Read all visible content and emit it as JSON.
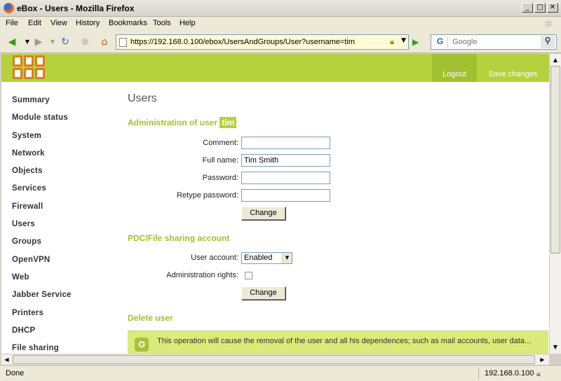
{
  "window": {
    "title": "eBox - Users - Mozilla Firefox"
  },
  "menubar": {
    "items": [
      "File",
      "Edit",
      "View",
      "History",
      "Bookmarks",
      "Tools",
      "Help"
    ]
  },
  "navbar": {
    "url": "https://192.168.0.100/ebox/UsersAndGroups/User?username=tim",
    "search_placeholder": "Google",
    "search_engine": "G"
  },
  "header": {
    "logout": "Logout",
    "save": "Save changes"
  },
  "sidebar": {
    "items": [
      "Summary",
      "Module status",
      "System",
      "Network",
      "Objects",
      "Services",
      "Firewall",
      "Users",
      "Groups",
      "OpenVPN",
      "Web",
      "Jabber Service",
      "Printers",
      "DHCP",
      "File sharing"
    ]
  },
  "main": {
    "title": "Users",
    "admin_heading": "Administration of user",
    "username": "tim",
    "fields": {
      "comment_label": "Comment:",
      "comment_value": "",
      "fullname_label": "Full name:",
      "fullname_value": "Tim Smith",
      "password_label": "Password:",
      "retype_label": "Retype password:"
    },
    "change_button": "Change",
    "pdc_heading": "PDC/File sharing account",
    "user_account_label": "User account:",
    "user_account_value": "Enabled",
    "admin_rights_label": "Administration rights:",
    "admin_rights_checked": false,
    "change_button2": "Change",
    "delete_heading": "Delete user",
    "warning_text": "This operation will cause the removal of the user and all his dependences; such as mail accounts, user data..."
  },
  "statusbar": {
    "status": "Done",
    "host": "192.168.0.100"
  },
  "colors": {
    "accent": "#b5d23e",
    "heading": "#a3c030",
    "warning_bg": "#dcea7a"
  }
}
